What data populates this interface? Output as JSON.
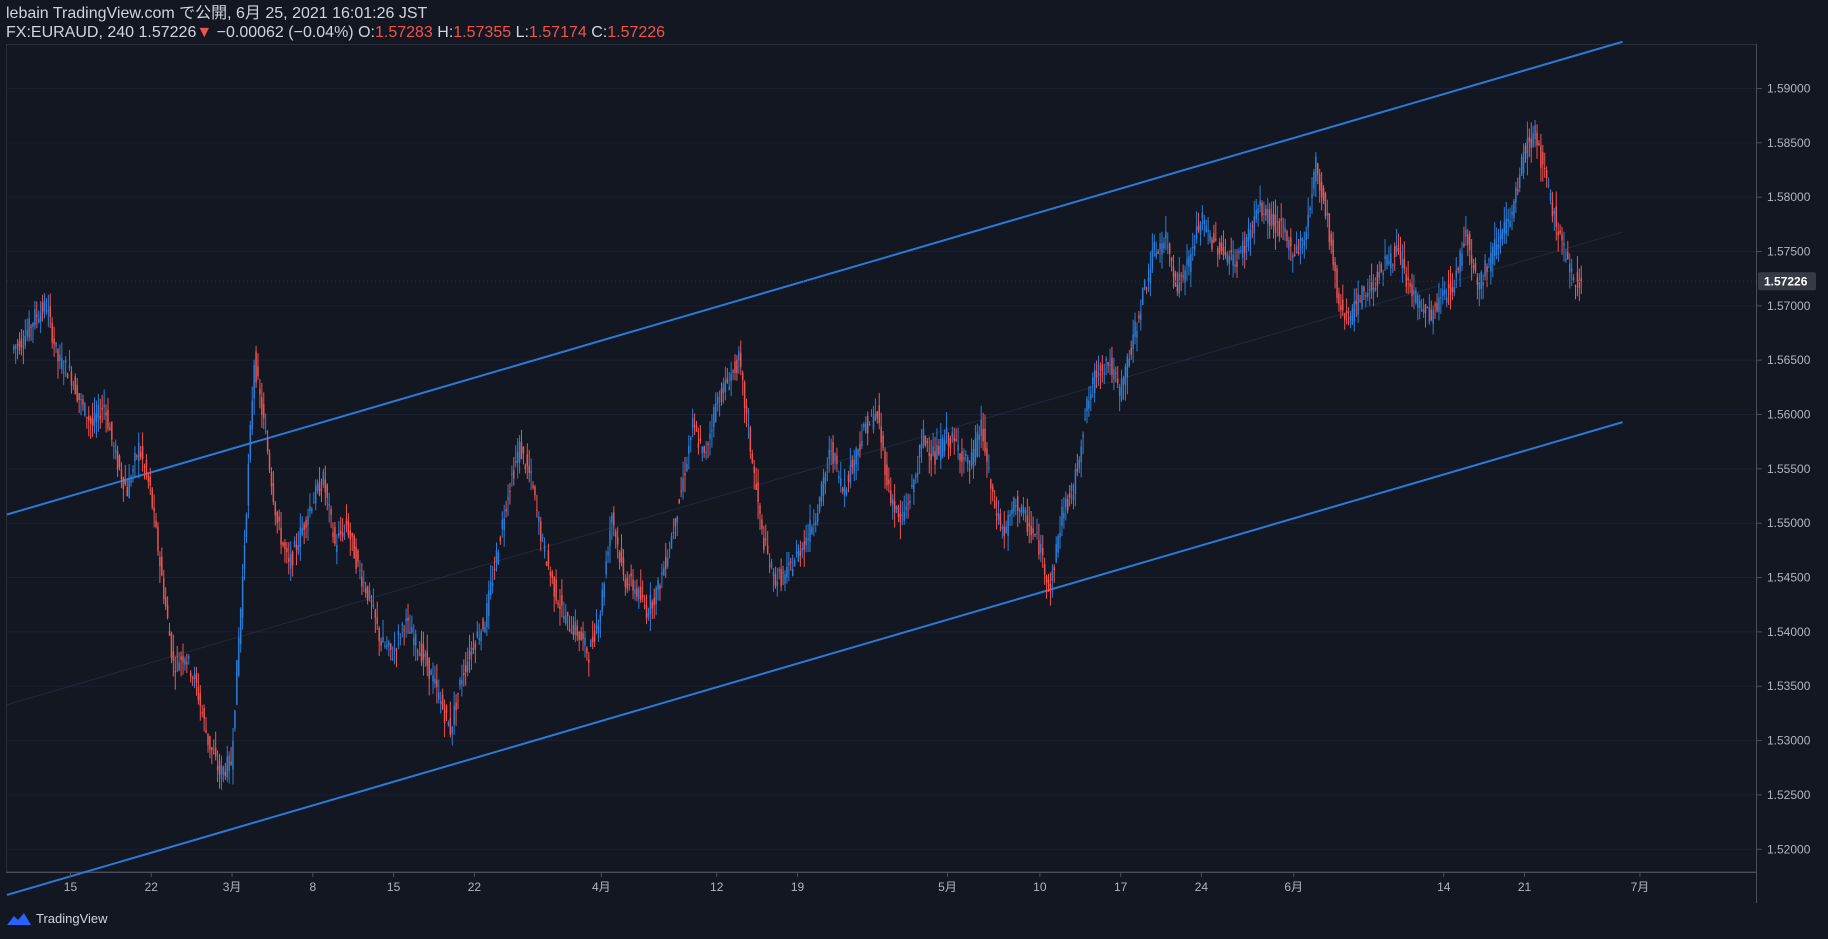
{
  "header": {
    "line1": "lebain TradingView.com で公開, 6月 25, 2021 16:01:26 JST",
    "symbol": "FX:EURAUD, 240",
    "last": "1.57226",
    "change_arrow": "▼",
    "change": "−0.00062 (−0.04%)",
    "o_label": "O:",
    "o": "1.57283",
    "h_label": "H:",
    "h": "1.57355",
    "l_label": "L:",
    "l": "1.57174",
    "c_label": "C:",
    "c": "1.57226"
  },
  "footer": {
    "brand": "TradingView",
    "logo_icon": "tradingview-logo-icon"
  },
  "colors": {
    "background": "#131722",
    "up": "#2e7dd6",
    "down": "#ef5350",
    "trendline": "#2a7ad8",
    "axis_text": "#b2b5be",
    "price_label_bg": "#363a45"
  },
  "chart_data": {
    "type": "candlestick",
    "symbol": "FX:EURAUD",
    "interval": "240",
    "ylim": [
      1.518,
      1.594
    ],
    "y_ticks": [
      "1.52000",
      "1.52500",
      "1.53000",
      "1.53500",
      "1.54000",
      "1.54500",
      "1.55000",
      "1.55500",
      "1.56000",
      "1.56500",
      "1.57000",
      "1.57500",
      "1.58000",
      "1.58500",
      "1.59000"
    ],
    "last_price_label": "1.57226",
    "last_price": 1.57226,
    "x_range_days": [
      0,
      136
    ],
    "x_ticks": [
      {
        "day": 5,
        "label": "15"
      },
      {
        "day": 12,
        "label": "22"
      },
      {
        "day": 19,
        "label": "3月"
      },
      {
        "day": 26,
        "label": "8"
      },
      {
        "day": 33,
        "label": "15"
      },
      {
        "day": 40,
        "label": "22"
      },
      {
        "day": 51,
        "label": "4月"
      },
      {
        "day": 61,
        "label": "12"
      },
      {
        "day": 68,
        "label": "19"
      },
      {
        "day": 81,
        "label": "5月"
      },
      {
        "day": 89,
        "label": "10"
      },
      {
        "day": 96,
        "label": "17"
      },
      {
        "day": 103,
        "label": "24"
      },
      {
        "day": 111,
        "label": "6月"
      },
      {
        "day": 124,
        "label": "14"
      },
      {
        "day": 131,
        "label": "21"
      },
      {
        "day": 141,
        "label": "7月"
      }
    ],
    "price_path": [
      [
        0,
        1.566
      ],
      [
        1,
        1.567
      ],
      [
        2,
        1.569
      ],
      [
        3,
        1.57
      ],
      [
        4,
        1.565
      ],
      [
        5,
        1.564
      ],
      [
        6,
        1.561
      ],
      [
        7,
        1.559
      ],
      [
        8,
        1.561
      ],
      [
        9,
        1.556
      ],
      [
        10,
        1.553
      ],
      [
        11,
        1.557
      ],
      [
        12,
        1.553
      ],
      [
        13,
        1.545
      ],
      [
        14,
        1.537
      ],
      [
        15,
        1.538
      ],
      [
        16,
        1.535
      ],
      [
        17,
        1.53
      ],
      [
        18,
        1.527
      ],
      [
        19,
        1.528
      ],
      [
        20,
        1.545
      ],
      [
        21,
        1.565
      ],
      [
        22,
        1.558
      ],
      [
        23,
        1.55
      ],
      [
        24,
        1.546
      ],
      [
        25,
        1.549
      ],
      [
        26,
        1.552
      ],
      [
        27,
        1.554
      ],
      [
        28,
        1.548
      ],
      [
        29,
        1.55
      ],
      [
        30,
        1.546
      ],
      [
        31,
        1.543
      ],
      [
        32,
        1.539
      ],
      [
        33,
        1.538
      ],
      [
        34,
        1.541
      ],
      [
        35,
        1.539
      ],
      [
        36,
        1.537
      ],
      [
        37,
        1.534
      ],
      [
        38,
        1.531
      ],
      [
        39,
        1.536
      ],
      [
        40,
        1.539
      ],
      [
        41,
        1.541
      ],
      [
        42,
        1.547
      ],
      [
        43,
        1.553
      ],
      [
        44,
        1.557
      ],
      [
        45,
        1.554
      ],
      [
        46,
        1.548
      ],
      [
        47,
        1.544
      ],
      [
        48,
        1.541
      ],
      [
        49,
        1.54
      ],
      [
        50,
        1.538
      ],
      [
        51,
        1.542
      ],
      [
        52,
        1.551
      ],
      [
        53,
        1.545
      ],
      [
        54,
        1.544
      ],
      [
        55,
        1.542
      ],
      [
        56,
        1.544
      ],
      [
        57,
        1.548
      ],
      [
        58,
        1.553
      ],
      [
        59,
        1.559
      ],
      [
        60,
        1.556
      ],
      [
        61,
        1.561
      ],
      [
        62,
        1.563
      ],
      [
        63,
        1.565
      ],
      [
        64,
        1.557
      ],
      [
        65,
        1.549
      ],
      [
        66,
        1.545
      ],
      [
        67,
        1.545
      ],
      [
        68,
        1.547
      ],
      [
        69,
        1.549
      ],
      [
        70,
        1.552
      ],
      [
        71,
        1.557
      ],
      [
        72,
        1.553
      ],
      [
        73,
        1.556
      ],
      [
        74,
        1.559
      ],
      [
        75,
        1.56
      ],
      [
        76,
        1.553
      ],
      [
        77,
        1.55
      ],
      [
        78,
        1.553
      ],
      [
        79,
        1.558
      ],
      [
        80,
        1.556
      ],
      [
        81,
        1.558
      ],
      [
        82,
        1.557
      ],
      [
        83,
        1.555
      ],
      [
        84,
        1.559
      ],
      [
        85,
        1.552
      ],
      [
        86,
        1.549
      ],
      [
        87,
        1.552
      ],
      [
        88,
        1.55
      ],
      [
        89,
        1.548
      ],
      [
        90,
        1.544
      ],
      [
        91,
        1.551
      ],
      [
        92,
        1.553
      ],
      [
        93,
        1.56
      ],
      [
        94,
        1.564
      ],
      [
        95,
        1.565
      ],
      [
        96,
        1.562
      ],
      [
        97,
        1.566
      ],
      [
        98,
        1.571
      ],
      [
        99,
        1.575
      ],
      [
        100,
        1.576
      ],
      [
        101,
        1.572
      ],
      [
        102,
        1.574
      ],
      [
        103,
        1.578
      ],
      [
        104,
        1.576
      ],
      [
        105,
        1.575
      ],
      [
        106,
        1.574
      ],
      [
        107,
        1.576
      ],
      [
        108,
        1.579
      ],
      [
        109,
        1.578
      ],
      [
        110,
        1.577
      ],
      [
        111,
        1.575
      ],
      [
        112,
        1.576
      ],
      [
        113,
        1.583
      ],
      [
        114,
        1.578
      ],
      [
        115,
        1.57
      ],
      [
        116,
        1.569
      ],
      [
        117,
        1.571
      ],
      [
        118,
        1.572
      ],
      [
        119,
        1.574
      ],
      [
        120,
        1.575
      ],
      [
        121,
        1.572
      ],
      [
        122,
        1.57
      ],
      [
        123,
        1.569
      ],
      [
        124,
        1.571
      ],
      [
        125,
        1.572
      ],
      [
        126,
        1.577
      ],
      [
        127,
        1.572
      ],
      [
        128,
        1.574
      ],
      [
        129,
        1.577
      ],
      [
        130,
        1.578
      ],
      [
        131,
        1.584
      ],
      [
        132,
        1.586
      ],
      [
        133,
        1.581
      ],
      [
        134,
        1.577
      ],
      [
        135,
        1.573
      ],
      [
        136,
        1.57226
      ]
    ],
    "channel": {
      "upper": [
        [
          -0.5,
          1.5508
        ],
        [
          139.5,
          1.5943
        ]
      ],
      "middle": [
        [
          -0.5,
          1.5333
        ],
        [
          139.5,
          1.5768
        ]
      ],
      "lower": [
        [
          -0.5,
          1.5158
        ],
        [
          139.5,
          1.5593
        ]
      ]
    }
  }
}
